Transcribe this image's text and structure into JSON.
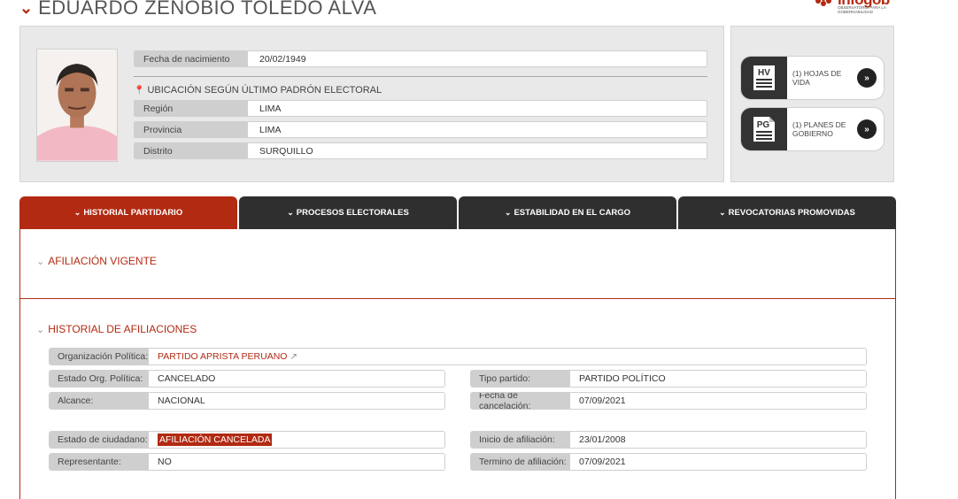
{
  "header": {
    "name": "EDUARDO ZENOBIO TOLEDO ALVA"
  },
  "logo": {
    "text": "infogob",
    "sub": "OBSERVATORIO PARA LA GOBERNABILIDAD",
    "color": "#b22a12"
  },
  "profile": {
    "birth_label": "Fecha de nacimiento",
    "birth_value": "20/02/1949",
    "location_heading": "UBICACIÓN SEGÚN ÚLTIMO PADRÓN ELECTORAL",
    "region_label": "Región",
    "region_value": "LIMA",
    "province_label": "Provincia",
    "province_value": "LIMA",
    "district_label": "Distrito",
    "district_value": "SURQUILLO"
  },
  "docs": {
    "hv_icon": "HV",
    "hv_label": "(1) HOJAS DE VIDA",
    "pg_icon": "PG",
    "pg_label": "(1) PLANES DE GOBIERNO"
  },
  "tabs": [
    {
      "label": "HISTORIAL PARTIDARIO",
      "active": true
    },
    {
      "label": "PROCESOS ELECTORALES",
      "active": false
    },
    {
      "label": "ESTABILIDAD EN EL CARGO",
      "active": false
    },
    {
      "label": "REVOCATORIAS PROMOVIDAS",
      "active": false
    }
  ],
  "sections": {
    "current": "AFILIACIÓN VIGENTE",
    "history": "HISTORIAL DE AFILIACIONES"
  },
  "affiliation": {
    "org_label": "Organización Política:",
    "org_value": "PARTIDO APRISTA PERUANO",
    "org_state_label": "Estado Org. Política:",
    "org_state_value": "CANCELADO",
    "party_type_label": "Tipo partido:",
    "party_type_value": "PARTIDO POLÍTICO",
    "scope_label": "Alcance:",
    "scope_value": "NACIONAL",
    "cancel_date_label": "Fecha de cancelación:",
    "cancel_date_value": "07/09/2021",
    "citizen_state_label": "Estado de ciudadano:",
    "citizen_state_value": "AFILIACIÓN CANCELADA",
    "start_label": "Inicio de afiliación:",
    "start_value": "23/01/2008",
    "rep_label": "Representante:",
    "rep_value": "NO",
    "end_label": "Termino de afiliación:",
    "end_value": "07/09/2021"
  },
  "colors": {
    "accent": "#b22a12",
    "dark_tab": "#2f2f2f",
    "panel": "#e9e9e9",
    "label_bg": "#cfcfcf"
  }
}
